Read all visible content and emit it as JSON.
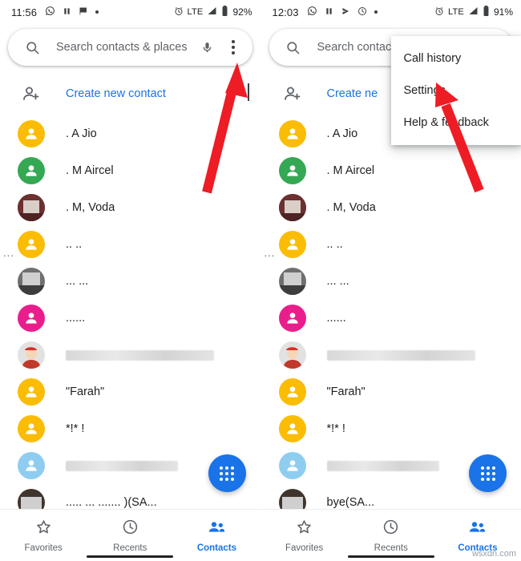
{
  "left": {
    "status": {
      "time": "11:56",
      "network": "LTE",
      "battery": "92%",
      "icons": [
        "whatsapp-icon",
        "pause-icon",
        "flag-icon",
        "dot-icon",
        "alarm-icon",
        "signal-icon",
        "battery-icon"
      ]
    },
    "search": {
      "placeholder": "Search contacts & places",
      "mic_icon": "microphone-icon",
      "menu_icon": "overflow-menu-icon",
      "search_icon": "search-icon"
    },
    "create_contact_label": "Create new contact",
    "side_dots": "...",
    "contacts": [
      {
        "name": ". A Jio",
        "avatar": "person-yellow",
        "blur": false
      },
      {
        "name": ". M Aircel",
        "avatar": "person-green",
        "blur": false
      },
      {
        "name": ". M, Voda",
        "avatar": "photo-maroon",
        "blur": false
      },
      {
        "name": ".. ..",
        "avatar": "person-yellow",
        "blur": false
      },
      {
        "name": "... ...",
        "avatar": "photo-gray",
        "blur": false
      },
      {
        "name": "......",
        "avatar": "person-pink",
        "blur": false
      },
      {
        "name": "\"*!:&.!*.!.*.&.!.( *.!.!.*.!!.*.!.*",
        "avatar": "photo-santa",
        "blur": true
      },
      {
        "name": "\"Farah\"",
        "avatar": "person-yellow",
        "blur": false
      },
      {
        "name": "*!* !",
        "avatar": "person-yellow",
        "blur": false
      },
      {
        "name": "",
        "avatar": "person-lightblue",
        "blur": true
      },
      {
        "name": "..... ... .......  )(SA...",
        "avatar": "photo-dark",
        "blur": true
      }
    ],
    "fab": "dialpad-fab",
    "bottom_nav": [
      {
        "label": "Favorites",
        "icon": "star-icon",
        "active": false
      },
      {
        "label": "Recents",
        "icon": "clock-icon",
        "active": false
      },
      {
        "label": "Contacts",
        "icon": "contacts-icon",
        "active": true
      }
    ]
  },
  "right": {
    "status": {
      "time": "12:03",
      "network": "LTE",
      "battery": "91%",
      "icons": [
        "whatsapp-icon",
        "pause-icon",
        "send-icon",
        "clock-icon",
        "dot-icon",
        "alarm-icon",
        "signal-icon",
        "battery-icon"
      ]
    },
    "search": {
      "placeholder": "Search contacts &",
      "search_icon": "search-icon"
    },
    "create_contact_label": "Create ne",
    "side_dots": "...",
    "menu": {
      "items": [
        "Call history",
        "Settings",
        "Help & feedback"
      ]
    },
    "contacts": [
      {
        "name": ". A Jio",
        "avatar": "person-yellow",
        "blur": false
      },
      {
        "name": ". M Aircel",
        "avatar": "person-green",
        "blur": false
      },
      {
        "name": ". M, Voda",
        "avatar": "photo-maroon",
        "blur": false
      },
      {
        "name": ".. ..",
        "avatar": "person-yellow",
        "blur": false
      },
      {
        "name": "... ...",
        "avatar": "photo-gray",
        "blur": false
      },
      {
        "name": "......",
        "avatar": "person-pink",
        "blur": false
      },
      {
        "name": "",
        "avatar": "photo-santa",
        "blur": true
      },
      {
        "name": "\"Farah\"",
        "avatar": "person-yellow",
        "blur": false
      },
      {
        "name": "*!* !",
        "avatar": "person-yellow",
        "blur": false
      },
      {
        "name": "",
        "avatar": "person-lightblue",
        "blur": true
      },
      {
        "name": "bye(SA...",
        "avatar": "photo-dark",
        "blur": true
      }
    ],
    "fab": "dialpad-fab",
    "bottom_nav": [
      {
        "label": "Favorites",
        "icon": "star-icon",
        "active": false
      },
      {
        "label": "Recents",
        "icon": "clock-icon",
        "active": false
      },
      {
        "label": "Contacts",
        "icon": "contacts-icon",
        "active": true
      }
    ]
  },
  "annotations": {
    "arrow_color": "#ee1c24",
    "arrow_left_target": "overflow-menu-icon",
    "arrow_right_target": "settings-menu-item"
  },
  "watermark": "wsxdn.com"
}
